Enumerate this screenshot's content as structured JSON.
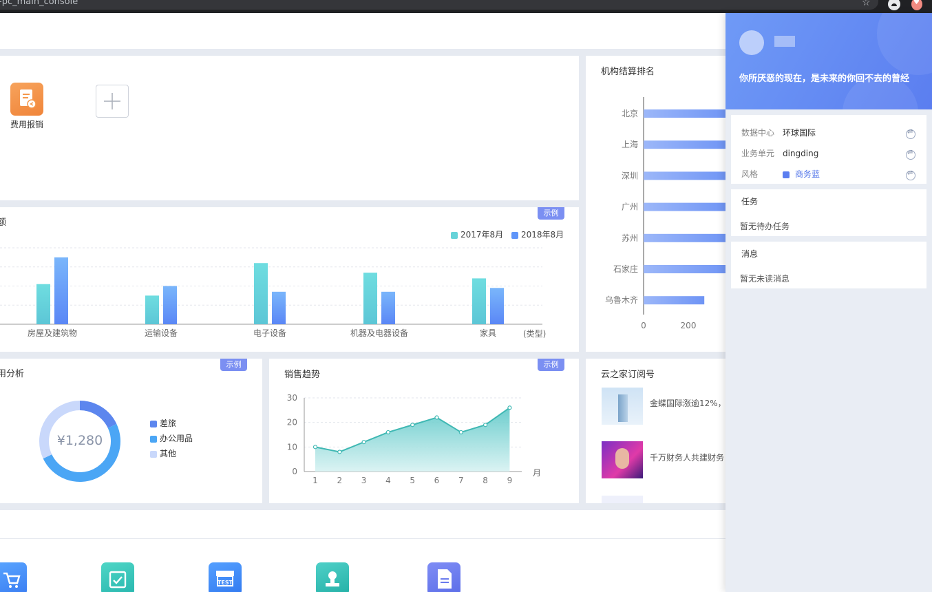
{
  "browser": {
    "url": "-pc_main_console"
  },
  "apps": {
    "expense_label": "费用报销"
  },
  "bar_card": {
    "title": "额",
    "badge": "示例",
    "legend": [
      "2017年8月",
      "2018年8月"
    ],
    "x_unit": "(类型)"
  },
  "ranking_card": {
    "title": "机构结算排名",
    "x_ticks": [
      "0",
      "200"
    ]
  },
  "donut_card": {
    "title": "用分析",
    "badge": "示例",
    "center_value": "¥1,280",
    "legend": [
      "差旅",
      "办公用品",
      "其他"
    ]
  },
  "line_card": {
    "title": "销售趋势",
    "badge": "示例",
    "x_unit": "月"
  },
  "subscribe_card": {
    "title": "云之家订阅号",
    "items": [
      "金蝶国际涨逾12%，",
      "千万财务人共建财务"
    ]
  },
  "colors": {
    "teal": "#66d3d9",
    "blue": "#5f95f9",
    "accent": "#7b8ff2",
    "donut_travel": "#5c86ee",
    "donut_office": "#4ba6f5",
    "donut_other": "#c9d8fb"
  },
  "chart_data": [
    {
      "type": "bar",
      "categories": [
        "房屋及建筑物",
        "运输设备",
        "电子设备",
        "机器及电器设备",
        "家具"
      ],
      "series": [
        {
          "name": "2017年8月",
          "values": [
            21,
            15,
            32,
            27,
            24
          ]
        },
        {
          "name": "2018年8月",
          "values": [
            35,
            20,
            17,
            17,
            19
          ]
        }
      ],
      "xlabel": "(类型)",
      "ylim": [
        0,
        40
      ]
    },
    {
      "type": "bar",
      "orientation": "horizontal",
      "categories": [
        "北京",
        "上海",
        "深圳",
        "广州",
        "苏州",
        "石家庄",
        "乌鲁木齐"
      ],
      "values": [
        400,
        400,
        400,
        400,
        400,
        400,
        280
      ],
      "xlim": [
        0,
        400
      ]
    },
    {
      "type": "pie",
      "donut": true,
      "center_label": "¥1,280",
      "labels": [
        "差旅",
        "办公用品",
        "其他"
      ],
      "values": [
        18,
        50,
        32
      ]
    },
    {
      "type": "area",
      "x": [
        1,
        2,
        3,
        4,
        5,
        6,
        7,
        8,
        9
      ],
      "values": [
        10,
        8,
        12,
        16,
        19,
        22,
        16,
        19,
        26
      ],
      "xlabel": "月",
      "ylim": [
        0,
        30
      ],
      "y_ticks": [
        0,
        10,
        20,
        30
      ]
    }
  ],
  "drawer": {
    "motto": "你所厌恶的现在，是未来的你回不去的曾经",
    "settings": [
      {
        "label": "数据中心",
        "value": "环球国际"
      },
      {
        "label": "业务单元",
        "value": "dingding"
      },
      {
        "label": "风格",
        "value": "商务蓝"
      }
    ],
    "tasks": {
      "title": "任务",
      "empty": "暂无待办任务"
    },
    "messages": {
      "title": "消息",
      "empty": "暂无未读消息"
    }
  }
}
